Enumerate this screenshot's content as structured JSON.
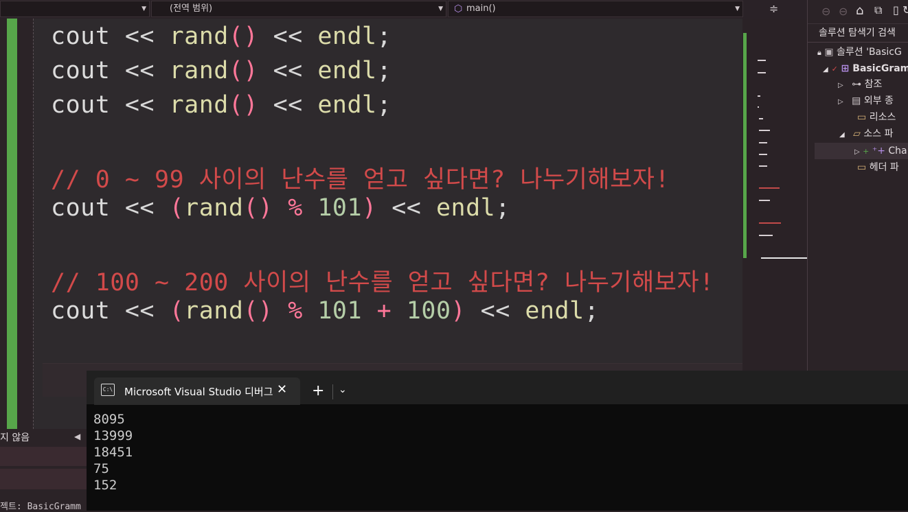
{
  "navbar": {
    "dropdown1": "",
    "dropdown2": "(전역 범위)",
    "dropdown3": "main()",
    "split_icon": "split-icon"
  },
  "editor": {
    "lines": [
      {
        "parts": [
          [
            "k",
            "cout "
          ],
          [
            "o",
            "<< "
          ],
          [
            "f",
            "rand"
          ],
          [
            "p",
            "()"
          ],
          [
            "o",
            " << "
          ],
          [
            "f",
            "endl"
          ],
          [
            "o",
            ";"
          ]
        ]
      },
      {
        "parts": [
          [
            "k",
            "cout "
          ],
          [
            "o",
            "<< "
          ],
          [
            "f",
            "rand"
          ],
          [
            "p",
            "()"
          ],
          [
            "o",
            " << "
          ],
          [
            "f",
            "endl"
          ],
          [
            "o",
            ";"
          ]
        ]
      },
      {
        "parts": [
          [
            "k",
            "cout "
          ],
          [
            "o",
            "<< "
          ],
          [
            "f",
            "rand"
          ],
          [
            "p",
            "()"
          ],
          [
            "o",
            " << "
          ],
          [
            "f",
            "endl"
          ],
          [
            "o",
            ";"
          ]
        ]
      },
      {
        "parts": [
          [
            "c",
            "// 0 ~ 99 사이의 난수를 얻고 싶다면? 나누기해보자!"
          ]
        ]
      },
      {
        "parts": [
          [
            "k",
            "cout "
          ],
          [
            "o",
            "<< "
          ],
          [
            "p",
            "("
          ],
          [
            "f",
            "rand"
          ],
          [
            "p",
            "()"
          ],
          [
            "o",
            " "
          ],
          [
            "p",
            "%"
          ],
          [
            "o",
            " "
          ],
          [
            "n",
            "101"
          ],
          [
            "p",
            ")"
          ],
          [
            "o",
            " << "
          ],
          [
            "f",
            "endl"
          ],
          [
            "o",
            ";"
          ]
        ]
      },
      {
        "parts": [
          [
            "c",
            "// 100 ~ 200 사이의 난수를 얻고 싶다면? 나누기해보자!"
          ]
        ]
      },
      {
        "parts": [
          [
            "k",
            "cout "
          ],
          [
            "o",
            "<< "
          ],
          [
            "p",
            "("
          ],
          [
            "f",
            "rand"
          ],
          [
            "p",
            "()"
          ],
          [
            "o",
            " "
          ],
          [
            "p",
            "%"
          ],
          [
            "o",
            " "
          ],
          [
            "n",
            "101"
          ],
          [
            "o",
            " "
          ],
          [
            "p",
            "+"
          ],
          [
            "o",
            " "
          ],
          [
            "n",
            "100"
          ],
          [
            "p",
            ")"
          ],
          [
            "o",
            " << "
          ],
          [
            "f",
            "endl"
          ],
          [
            "o",
            ";"
          ]
        ]
      }
    ]
  },
  "solution_explorer": {
    "search_label": "솔루션 탐색기 검색",
    "solution_label": "솔루션 'BasicG",
    "project_label": "BasicGram",
    "items": [
      {
        "label": "참조",
        "icon": "references-icon"
      },
      {
        "label": "외부 종",
        "icon": "external-deps-icon"
      },
      {
        "label": "리소스",
        "icon": "filter-folder-icon"
      },
      {
        "label": "소스 파",
        "icon": "filter-folder-open-icon"
      },
      {
        "label": "Cha",
        "icon": "cpp-file-icon"
      },
      {
        "label": "헤더 파",
        "icon": "filter-folder-icon"
      }
    ]
  },
  "status": {
    "issues_text": "지 않음",
    "project_text": "젝트: BasicGramm"
  },
  "terminal": {
    "tab_title": "Microsoft Visual Studio 디버그",
    "output": [
      "8095",
      "13999",
      "18451",
      "75",
      "152"
    ]
  },
  "colors": {
    "comment": "#d24a4a",
    "function": "#dcdcaa",
    "paren": "#ff7799",
    "change_bar": "#57a64a"
  }
}
